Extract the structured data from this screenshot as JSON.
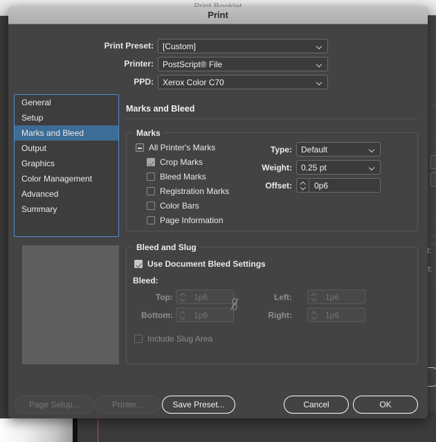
{
  "background_window": {
    "title": "Print Booklet",
    "partial_labels": [
      "eft:",
      "ght:",
      ":",
      ":"
    ]
  },
  "dialog": {
    "title": "Print",
    "top_fields": [
      {
        "label": "Print Preset:",
        "value": "[Custom]",
        "name": "print-preset"
      },
      {
        "label": "Printer:",
        "value": "PostScript® File",
        "name": "printer"
      },
      {
        "label": "PPD:",
        "value": "Xerox Color C70",
        "name": "ppd"
      }
    ],
    "sidebar": {
      "items": [
        {
          "label": "General",
          "selected": false
        },
        {
          "label": "Setup",
          "selected": false
        },
        {
          "label": "Marks and Bleed",
          "selected": true
        },
        {
          "label": "Output",
          "selected": false
        },
        {
          "label": "Graphics",
          "selected": false
        },
        {
          "label": "Color Management",
          "selected": false
        },
        {
          "label": "Advanced",
          "selected": false
        },
        {
          "label": "Summary",
          "selected": false
        }
      ],
      "selected_index": 2,
      "accent_color": "#4f8fd0",
      "selected_color": "#3d6c96"
    },
    "pane": {
      "title": "Marks and Bleed",
      "marks_group": {
        "title": "Marks",
        "checkboxes": [
          {
            "label": "All Printer's Marks",
            "state": "mixed",
            "enabled": true
          },
          {
            "label": "Crop Marks",
            "state": "checked",
            "enabled": true
          },
          {
            "label": "Bleed Marks",
            "state": "unchecked",
            "enabled": true
          },
          {
            "label": "Registration Marks",
            "state": "unchecked",
            "enabled": true
          },
          {
            "label": "Color Bars",
            "state": "unchecked",
            "enabled": true
          },
          {
            "label": "Page Information",
            "state": "unchecked",
            "enabled": true
          }
        ],
        "fields": [
          {
            "label": "Type:",
            "value": "Default",
            "kind": "select"
          },
          {
            "label": "Weight:",
            "value": "0.25 pt",
            "kind": "select"
          },
          {
            "label": "Offset:",
            "value": "0p6",
            "kind": "stepper"
          }
        ]
      },
      "bleed_group": {
        "title": "Bleed and Slug",
        "use_document_bleed": {
          "label": "Use Document Bleed Settings",
          "state": "checked",
          "enabled": true
        },
        "bleed_label": "Bleed:",
        "fields": [
          {
            "label": "Top:",
            "value": "1p6",
            "enabled": false
          },
          {
            "label": "Bottom:",
            "value": "1p6",
            "enabled": false
          },
          {
            "label": "Left:",
            "value": "1p6",
            "enabled": false
          },
          {
            "label": "Right:",
            "value": "1p6",
            "enabled": false
          }
        ],
        "link_icon": "broken-chain-link",
        "include_slug": {
          "label": "Include Slug Area",
          "state": "unchecked",
          "enabled": false
        }
      }
    },
    "buttons": [
      {
        "label": "Page Setup...",
        "enabled": false,
        "name": "page-setup-button"
      },
      {
        "label": "Printer...",
        "enabled": false,
        "name": "printer-button"
      },
      {
        "label": "Save Preset...",
        "enabled": true,
        "name": "save-preset-button"
      },
      {
        "label": "Cancel",
        "enabled": true,
        "name": "cancel-button"
      },
      {
        "label": "OK",
        "enabled": true,
        "name": "ok-button"
      }
    ]
  }
}
